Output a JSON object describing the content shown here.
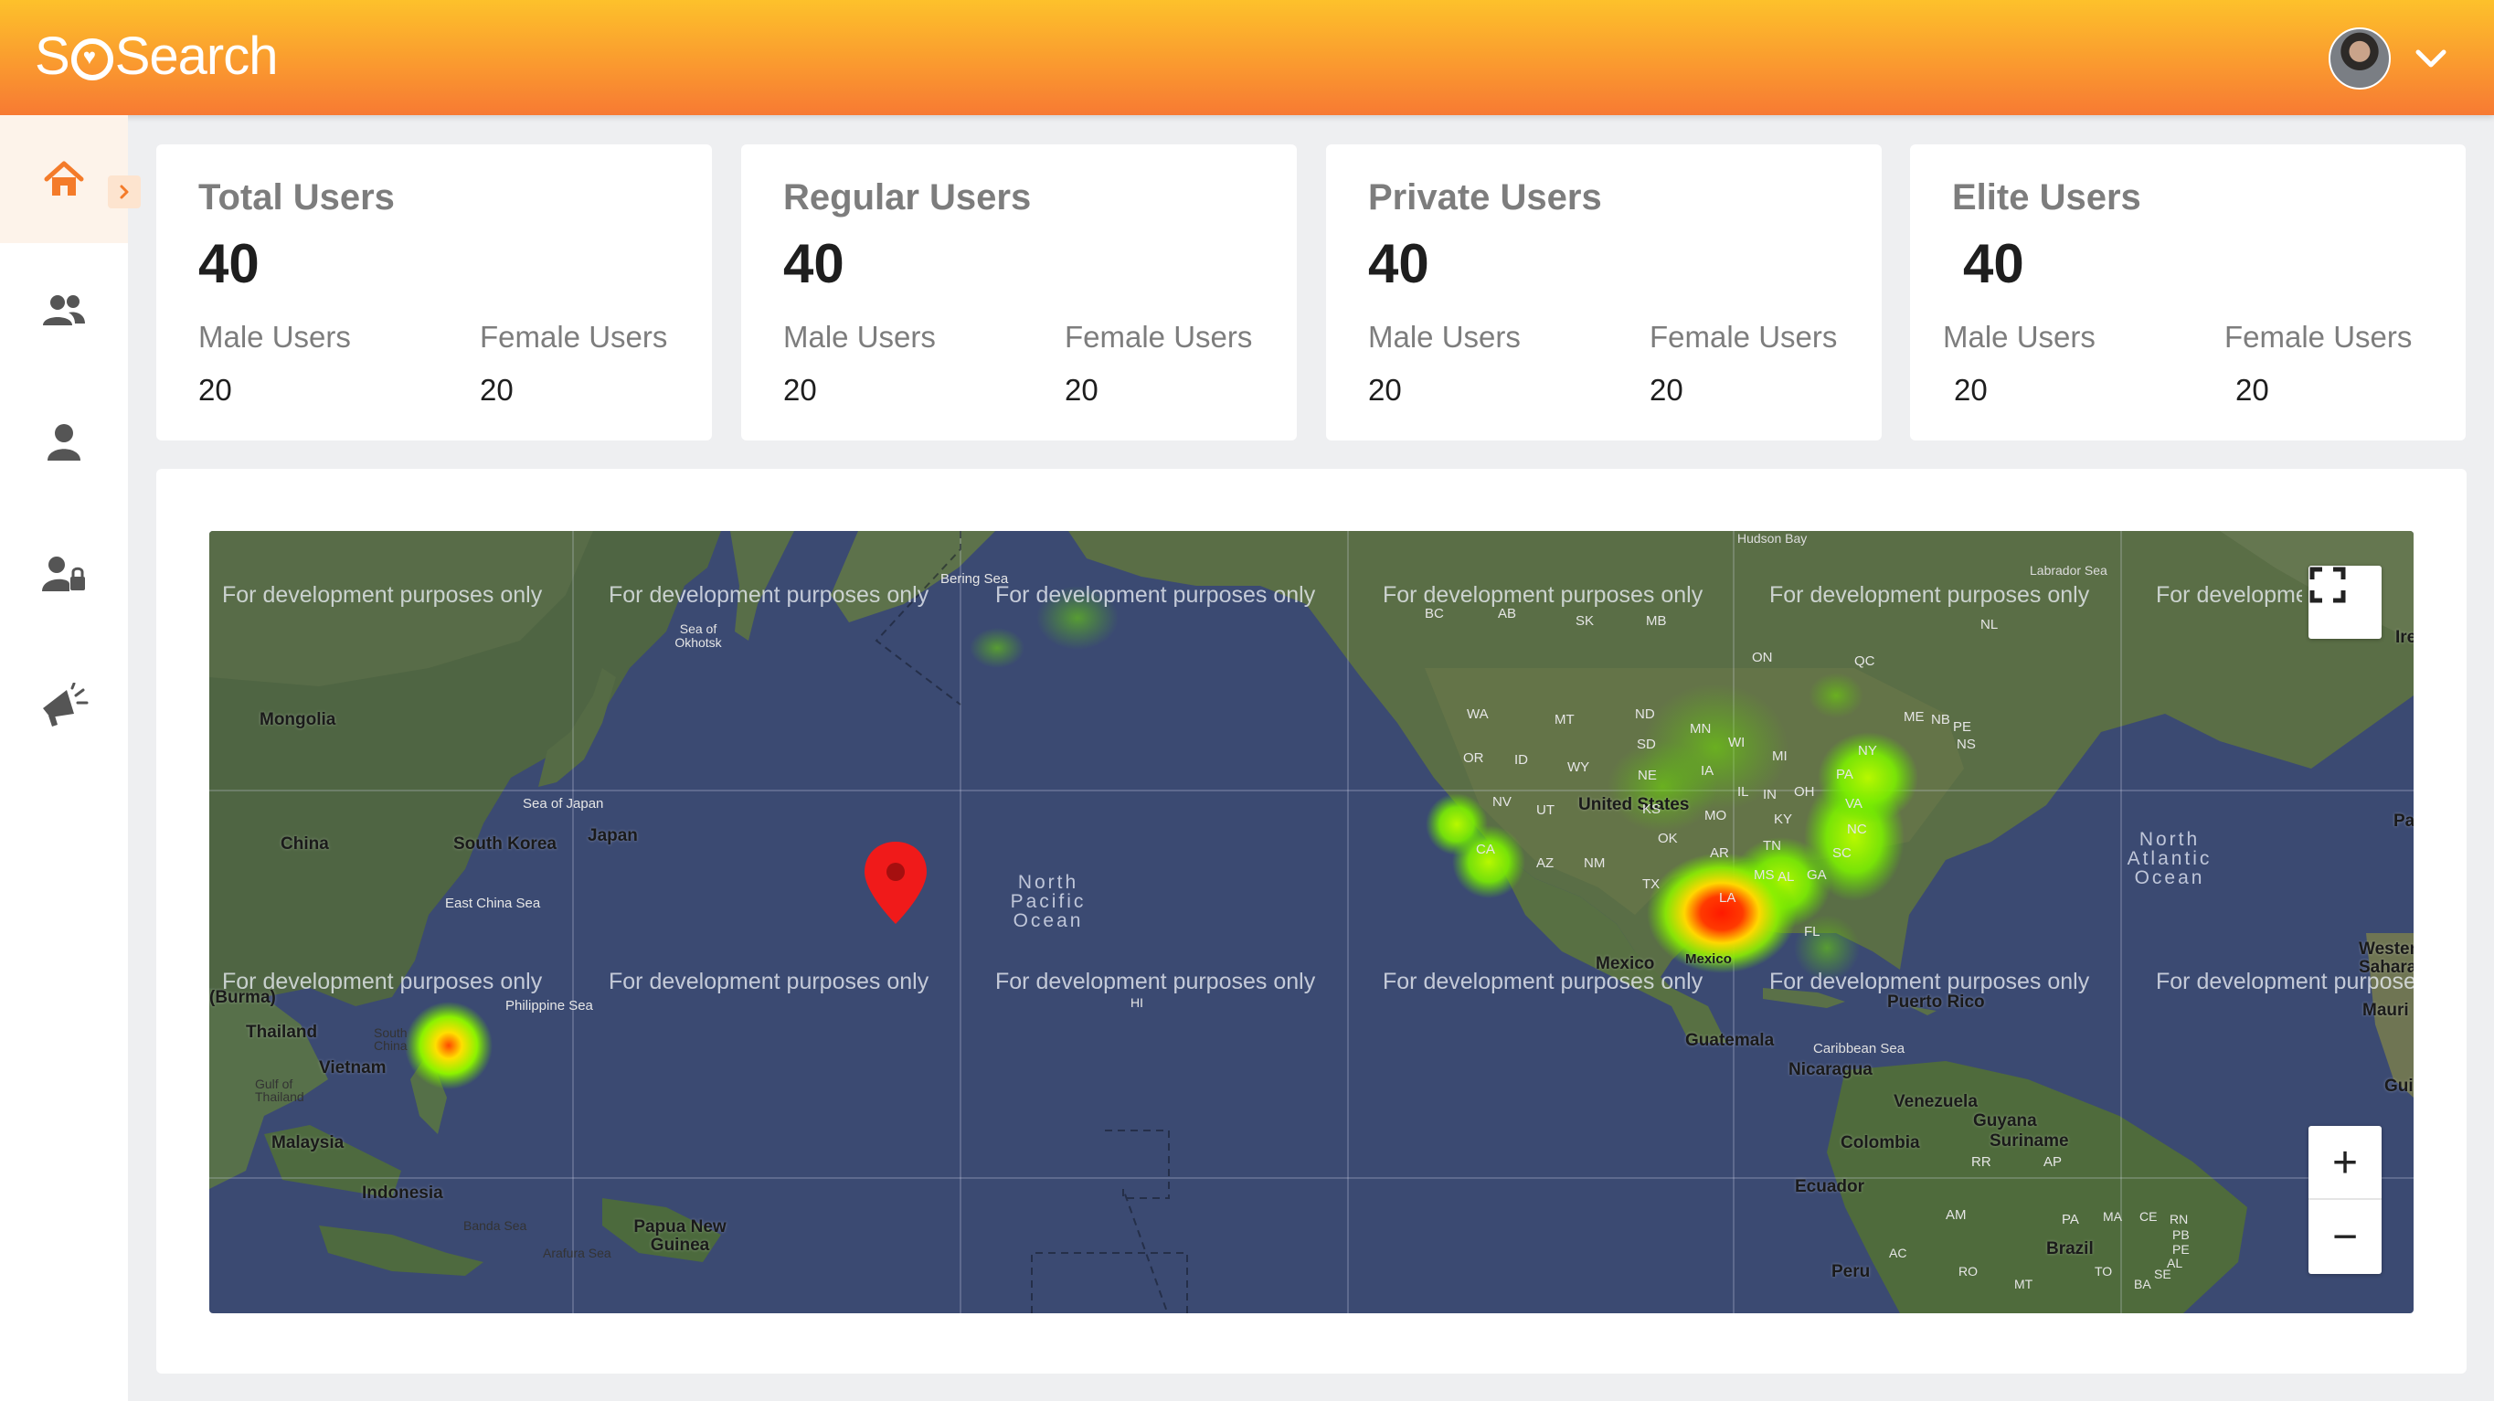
{
  "header": {
    "logo_text": "SQSearch",
    "logo_parts": [
      "S",
      "Search"
    ],
    "brand_color": "#f89a2e"
  },
  "sidebar": {
    "items": [
      {
        "icon": "home-icon",
        "active": true
      },
      {
        "icon": "users-icon",
        "active": false
      },
      {
        "icon": "user-icon",
        "active": false
      },
      {
        "icon": "user-lock-icon",
        "active": false
      },
      {
        "icon": "megaphone-icon",
        "active": false
      }
    ],
    "accent_color": "#f47b2a"
  },
  "cards": [
    {
      "title": "Total Users",
      "total": "40",
      "male_label": "Male Users",
      "female_label": "Female Users",
      "male": "20",
      "female": "20"
    },
    {
      "title": "Regular Users",
      "total": "40",
      "male_label": "Male Users",
      "female_label": "Female Users",
      "male": "20",
      "female": "20"
    },
    {
      "title": "Private Users",
      "total": "40",
      "male_label": "Male Users",
      "female_label": "Female Users",
      "male": "20",
      "female": "20"
    },
    {
      "title": "Elite Users",
      "total": "40",
      "male_label": "Male Users",
      "female_label": "Female Users",
      "male": "20",
      "female": "20"
    }
  ],
  "map": {
    "watermark": "For development purposes only",
    "places": {
      "mongolia": "Mongolia",
      "china": "China",
      "south_korea": "South Korea",
      "japan": "Japan",
      "sea_of_japan": "Sea of Japan",
      "east_china_sea": "East China Sea",
      "sea_of_okhotsk": "Sea of Okhotsk",
      "bering_sea": "Bering Sea",
      "burma": "(Burma)",
      "thailand": "Thailand",
      "vietnam": "Vietnam",
      "gulf_of_thailand": "Gulf of Thailand",
      "south_china": "South China",
      "philippine_sea": "Philippine Sea",
      "malaysia": "Malaysia",
      "indonesia": "Indonesia",
      "banda_sea": "Banda Sea",
      "arafura_sea": "Arafura Sea",
      "papua_new_guinea": "Papua New Guinea",
      "north_pacific_ocean": "North Pacific Ocean",
      "hi": "HI",
      "united_states": "United States",
      "mexico": "Mexico",
      "mexico_gulf": "Mexico",
      "guatemala": "Guatemala",
      "nicaragua": "Nicaragua",
      "caribbean_sea": "Caribbean Sea",
      "puerto_rico": "Puerto Rico",
      "venezuela": "Venezuela",
      "guyana": "Guyana",
      "suriname": "Suriname",
      "colombia": "Colombia",
      "ecuador": "Ecuador",
      "peru": "Peru",
      "brazil": "Brazil",
      "north_atlantic_ocean": "North Atlantic Ocean",
      "labrador_sea": "Labrador Sea",
      "hudson_bay": "Hudson Bay",
      "western_sahara": "Western Sahara",
      "mauritania": "Mauri",
      "gui": "Gui",
      "ire": "Ire",
      "pa": "Pa",
      "wa": "WA",
      "or": "OR",
      "nv": "NV",
      "ca": "CA",
      "az": "AZ",
      "nm": "NM",
      "ut": "UT",
      "id": "ID",
      "mt": "MT",
      "wy": "WY",
      "nd": "ND",
      "sd": "SD",
      "ne": "NE",
      "ks": "KS",
      "ok": "OK",
      "tx": "TX",
      "mn": "MN",
      "ia": "IA",
      "mo": "MO",
      "ar": "AR",
      "la": "LA",
      "wi": "WI",
      "il": "IL",
      "in": "IN",
      "mi": "MI",
      "oh": "OH",
      "ky": "KY",
      "tn": "TN",
      "ms": "MS",
      "al": "AL",
      "ga": "GA",
      "sc": "SC",
      "nc": "NC",
      "va": "VA",
      "pa_state": "PA",
      "ny": "NY",
      "me": "ME",
      "fl": "FL",
      "bc": "BC",
      "ab": "AB",
      "sk": "SK",
      "mb": "MB",
      "on": "ON",
      "qc": "QC",
      "nb": "NB",
      "ns": "NS",
      "pe": "PE",
      "nl": "NL",
      "rr": "RR",
      "ap": "AP",
      "am": "AM",
      "pa_br": "PA",
      "ma": "MA",
      "ce": "CE",
      "rn": "RN",
      "pb": "PB",
      "pe_br": "PE",
      "al_br": "AL",
      "se": "SE",
      "ba": "BA",
      "to": "TO",
      "ac": "AC",
      "ro": "RO",
      "mt_br": "MT"
    },
    "heat_colors": [
      "#7cf000",
      "#ffe800",
      "#ff2a00"
    ],
    "marker_color": "#f01a1a",
    "controls": {
      "fullscreen": "fullscreen-icon",
      "zoom_in": "+",
      "zoom_out": "−"
    }
  }
}
